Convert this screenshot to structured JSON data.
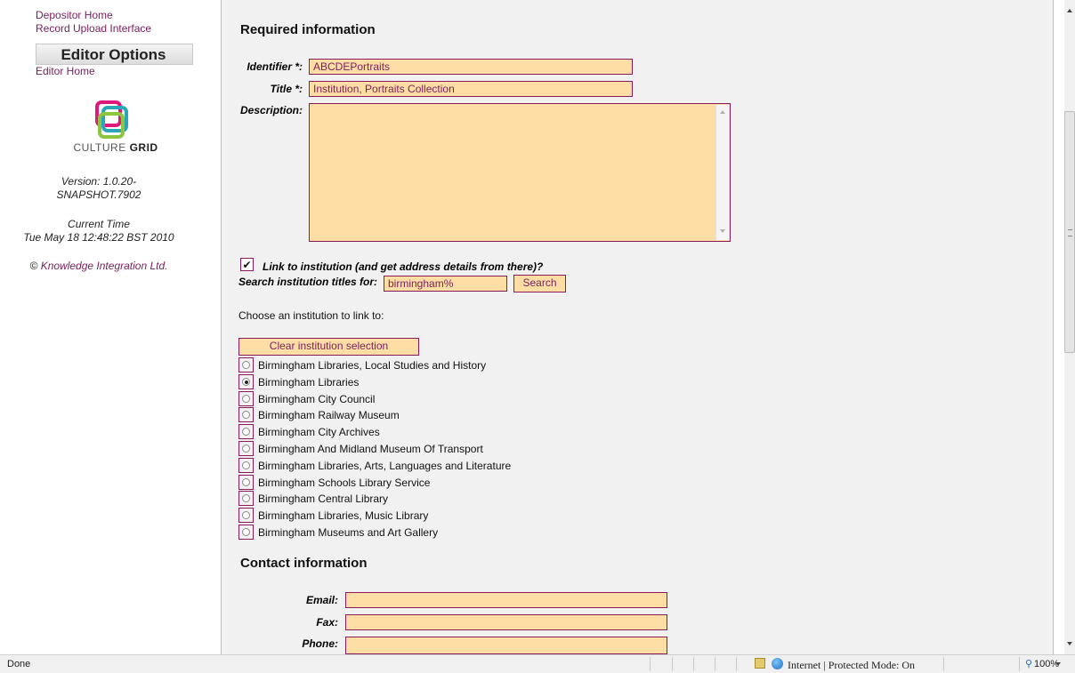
{
  "sidebar": {
    "depositor_home": "Depositor Home",
    "record_upload": "Record Upload Interface",
    "editor_options_title": "Editor Options",
    "editor_home": "Editor Home",
    "logo_text_1": "CULTURE",
    "logo_text_2": "GRID",
    "version_line1": "Version: 1.0.20-",
    "version_line2": "SNAPSHOT.7902",
    "current_time_label": "Current Time",
    "current_time_value": "Tue May 18 12:48:22 BST 2010",
    "copyright_symbol": "©",
    "copyright_link": "Knowledge Integration Ltd."
  },
  "required": {
    "heading": "Required information",
    "identifier_label": "Identifier *:",
    "identifier_value": "ABCDEPortraits",
    "title_label": "Title *:",
    "title_value": "Institution, Portraits Collection",
    "description_label": "Description:",
    "description_value": ""
  },
  "institution": {
    "link_checkbox_label": "Link to institution (and get address details from there)?",
    "link_checked": true,
    "search_label": "Search institution titles for:",
    "search_value": "birmingham%",
    "search_button": "Search",
    "choose_label": "Choose an institution to link to:",
    "clear_button": "Clear institution selection",
    "options": [
      {
        "label": "Birmingham Libraries, Local Studies and History",
        "selected": false
      },
      {
        "label": "Birmingham Libraries",
        "selected": true
      },
      {
        "label": "Birmingham City Council",
        "selected": false
      },
      {
        "label": "Birmingham Railway Museum",
        "selected": false
      },
      {
        "label": "Birmingham City Archives",
        "selected": false
      },
      {
        "label": "Birmingham And Midland Museum Of Transport",
        "selected": false
      },
      {
        "label": "Birmingham Libraries, Arts, Languages and Literature",
        "selected": false
      },
      {
        "label": "Birmingham Schools Library Service",
        "selected": false
      },
      {
        "label": "Birmingham Central Library",
        "selected": false
      },
      {
        "label": "Birmingham Libraries, Music Library",
        "selected": false
      },
      {
        "label": "Birmingham Museums and Art Gallery",
        "selected": false
      }
    ]
  },
  "contact": {
    "heading": "Contact information",
    "email_label": "Email:",
    "fax_label": "Fax:",
    "phone_label": "Phone:"
  },
  "status": {
    "left": "Done",
    "zone": "Internet | Protected Mode: On",
    "zoom": "100%"
  },
  "colors": {
    "field_bg": "#ffdea6",
    "field_border": "#8a1a5a",
    "link": "#7a1f5c"
  }
}
